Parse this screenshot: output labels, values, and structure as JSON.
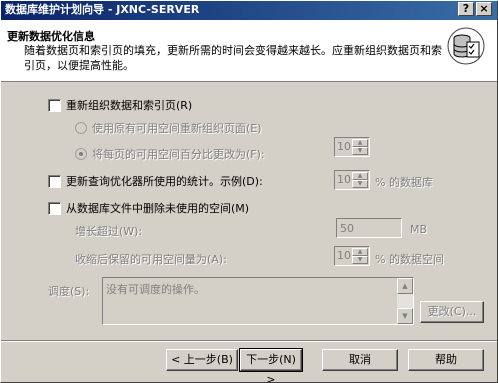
{
  "window": {
    "title": "数据库维护计划向导 - JXNC-SERVER",
    "help_glyph": "?",
    "close_glyph": "×"
  },
  "header": {
    "title": "更新数据优化信息",
    "description": "随着数据页和索引页的填充，更新所需的时间会变得越来越长。应重新组织数据页和索引页，以便提高性能。",
    "icon": "database-checklist-icon"
  },
  "options": {
    "reorganize": {
      "label": "重新组织数据和索引页(R)",
      "checked": false
    },
    "reorg_original": {
      "label": "使用原有可用空间重新组织页面(E)",
      "selected": false
    },
    "reorg_percent": {
      "label": "将每页的可用空间百分比更改为(F):",
      "selected": true,
      "value": "10"
    },
    "update_stats": {
      "label": "更新查询优化器所使用的统计。示例(D):",
      "checked": false,
      "value": "10",
      "suffix": "% 的数据库"
    },
    "shrink": {
      "label": "从数据库文件中删除未使用的空间(M)",
      "checked": false
    },
    "grow_exceeds": {
      "label": "增长超过(W):",
      "value": "50",
      "unit": "MB"
    },
    "free_after": {
      "label": "收缩后保留的可用空间量为(A):",
      "value": "10",
      "suffix": "% 的数据空间"
    }
  },
  "schedule": {
    "label": "调度(S):",
    "text": "没有可调度的操作。",
    "change_button": "更改(C)..."
  },
  "footer": {
    "back_button": "< 上一步(B)",
    "next_button": "下一步(N) >",
    "cancel_button": "取消",
    "help_button": "帮助"
  }
}
